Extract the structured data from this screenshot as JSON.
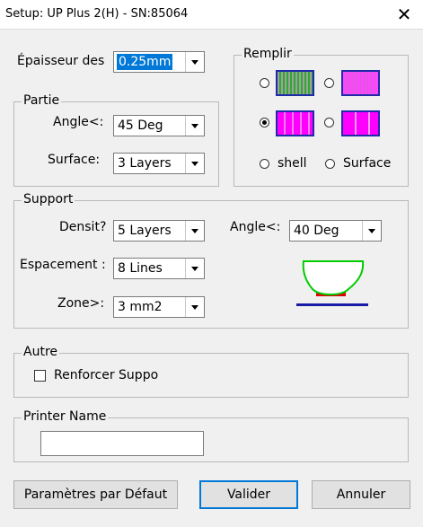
{
  "window": {
    "title": "Setup: UP Plus 2(H) - SN:85064",
    "close_glyph": "✕"
  },
  "layer_thickness": {
    "label": "Épaisseur des",
    "value": "0.25mm"
  },
  "partie": {
    "legend": "Partie",
    "angle_label": "Angle<:",
    "angle_value": "45 Deg",
    "surface_label": "Surface:",
    "surface_value": "3 Layers"
  },
  "remplir": {
    "legend": "Remplir",
    "fill_patterns": [
      {
        "id": "fill-dense",
        "selected": false,
        "colors": [
          "#a0a0a0",
          "#2eaa2e"
        ]
      },
      {
        "id": "fill-medium",
        "selected": false,
        "colors": [
          "#ff44ff",
          "#c26ac2"
        ]
      },
      {
        "id": "fill-loose",
        "selected": true,
        "colors": [
          "#ff00ff",
          "#f080f0"
        ]
      },
      {
        "id": "fill-sparse",
        "selected": false,
        "colors": [
          "#ff00ff",
          "#f8a0f8"
        ]
      }
    ],
    "shell_label": "shell",
    "surface_label": "Surface"
  },
  "support": {
    "legend": "Support",
    "density_label": "Densit?",
    "density_value": "5 Layers",
    "angle_label": "Angle<:",
    "angle_value": "40 Deg",
    "spacing_label": "Espacement :",
    "spacing_value": "8 Lines",
    "zone_label": "Zone>:",
    "zone_value": "3 mm2",
    "preview_colors": {
      "shell": "#00cc00",
      "support": "#e00000",
      "base": "#1a1aa8"
    }
  },
  "autre": {
    "legend": "Autre",
    "reinforce_label": "Renforcer Suppo",
    "reinforce_checked": false
  },
  "printer": {
    "legend": "Printer Name",
    "value": ""
  },
  "buttons": {
    "defaults_label": "Paramètres par Défaut",
    "ok_label": "Valider",
    "cancel_label": "Annuler"
  },
  "colors": {
    "selection": "#0078d7",
    "swatch_border": "#1f2aa8"
  }
}
